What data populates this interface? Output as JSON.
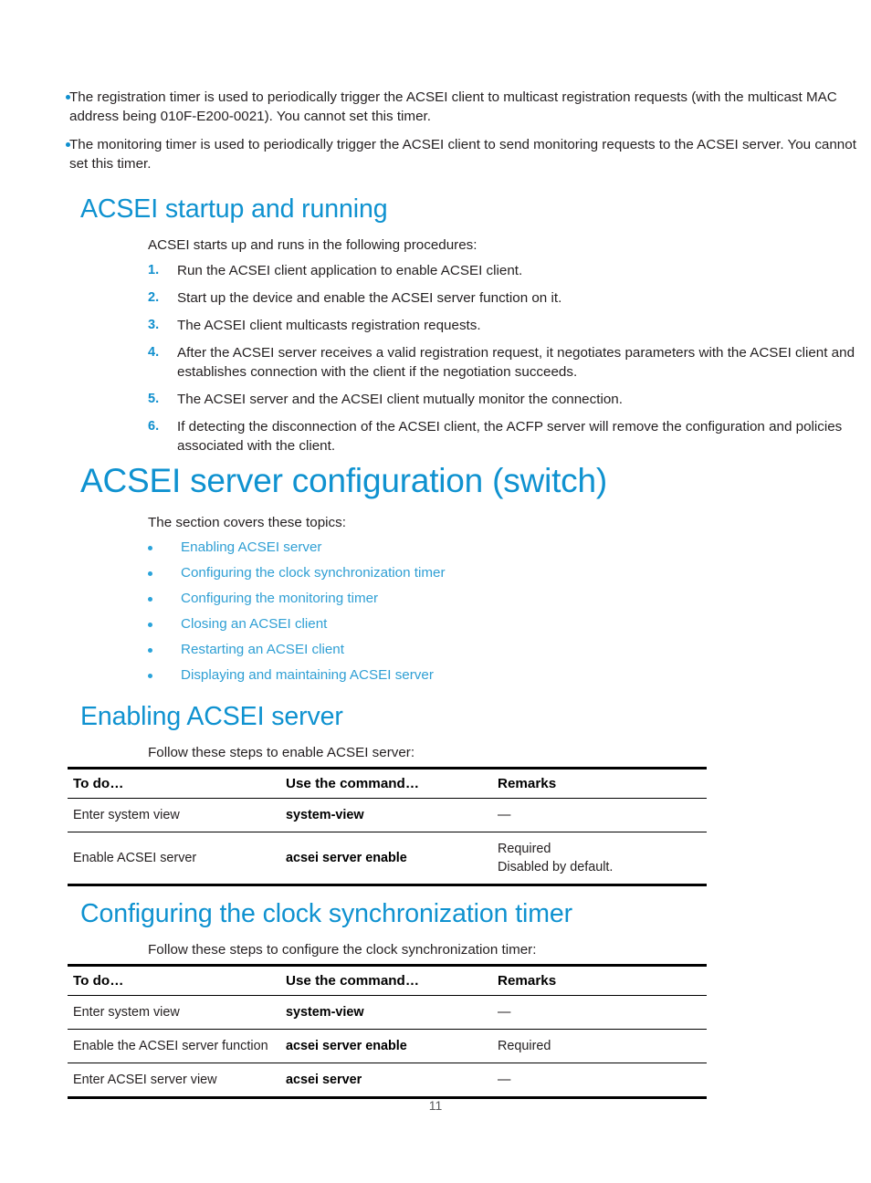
{
  "page": {
    "number": "11",
    "accent_heading_color": "#0f92d0",
    "accent_link_color": "#2f9fd4",
    "bullet_color": "#0f8fce",
    "body_color": "#231f20"
  },
  "intro_bullets": [
    "The registration timer is used to periodically trigger the ACSEI client to multicast registration requests (with the multicast MAC address being 010F-E200-0021). You cannot set this timer.",
    "The monitoring timer is used to periodically trigger the ACSEI client to send monitoring requests to the ACSEI server. You cannot set this timer."
  ],
  "startup_section": {
    "heading": "ACSEI startup and running",
    "intro": "ACSEI starts up and runs in the following procedures:",
    "steps": [
      {
        "num": "1.",
        "text": "Run the ACSEI client application to enable ACSEI client."
      },
      {
        "num": "2.",
        "text": "Start up the device and enable the ACSEI server function on it."
      },
      {
        "num": "3.",
        "text": "The ACSEI client multicasts registration requests."
      },
      {
        "num": "4.",
        "text": "After the ACSEI server receives a valid registration request, it negotiates parameters with the ACSEI client and establishes connection with the client if the negotiation succeeds."
      },
      {
        "num": "5.",
        "text": "The ACSEI server and the ACSEI client mutually monitor the connection."
      },
      {
        "num": "6.",
        "text": "If detecting the disconnection of the ACSEI client, the ACFP server will remove the configuration and policies associated with the client."
      }
    ]
  },
  "server_config_section": {
    "heading": "ACSEI server configuration (switch)",
    "intro": "The section covers these topics:",
    "topics": [
      "Enabling ACSEI server",
      "Configuring the clock synchronization timer",
      "Configuring the monitoring timer",
      "Closing an ACSEI client",
      "Restarting an ACSEI client",
      "Displaying and maintaining ACSEI server"
    ]
  },
  "enabling_section": {
    "heading": "Enabling ACSEI server",
    "intro": "Follow these steps to enable ACSEI server:",
    "table": {
      "headers": [
        "To do…",
        "Use the command…",
        "Remarks"
      ],
      "rows": [
        {
          "todo": "Enter system view",
          "command": "system-view",
          "remarks": [
            "—"
          ]
        },
        {
          "todo": "Enable ACSEI server",
          "command": "acsei server enable",
          "remarks": [
            "Required",
            "Disabled by default."
          ]
        }
      ]
    }
  },
  "clock_sync_section": {
    "heading": "Configuring the clock synchronization timer",
    "intro": "Follow these steps to configure the clock synchronization timer:",
    "table": {
      "headers": [
        "To do…",
        "Use the command…",
        "Remarks"
      ],
      "rows": [
        {
          "todo": "Enter system view",
          "command": "system-view",
          "remarks": [
            "—"
          ]
        },
        {
          "todo": "Enable the ACSEI server function",
          "command": "acsei server enable",
          "remarks": [
            "Required"
          ]
        },
        {
          "todo": "Enter ACSEI server view",
          "command": "acsei server",
          "remarks": [
            "—"
          ]
        }
      ]
    }
  }
}
